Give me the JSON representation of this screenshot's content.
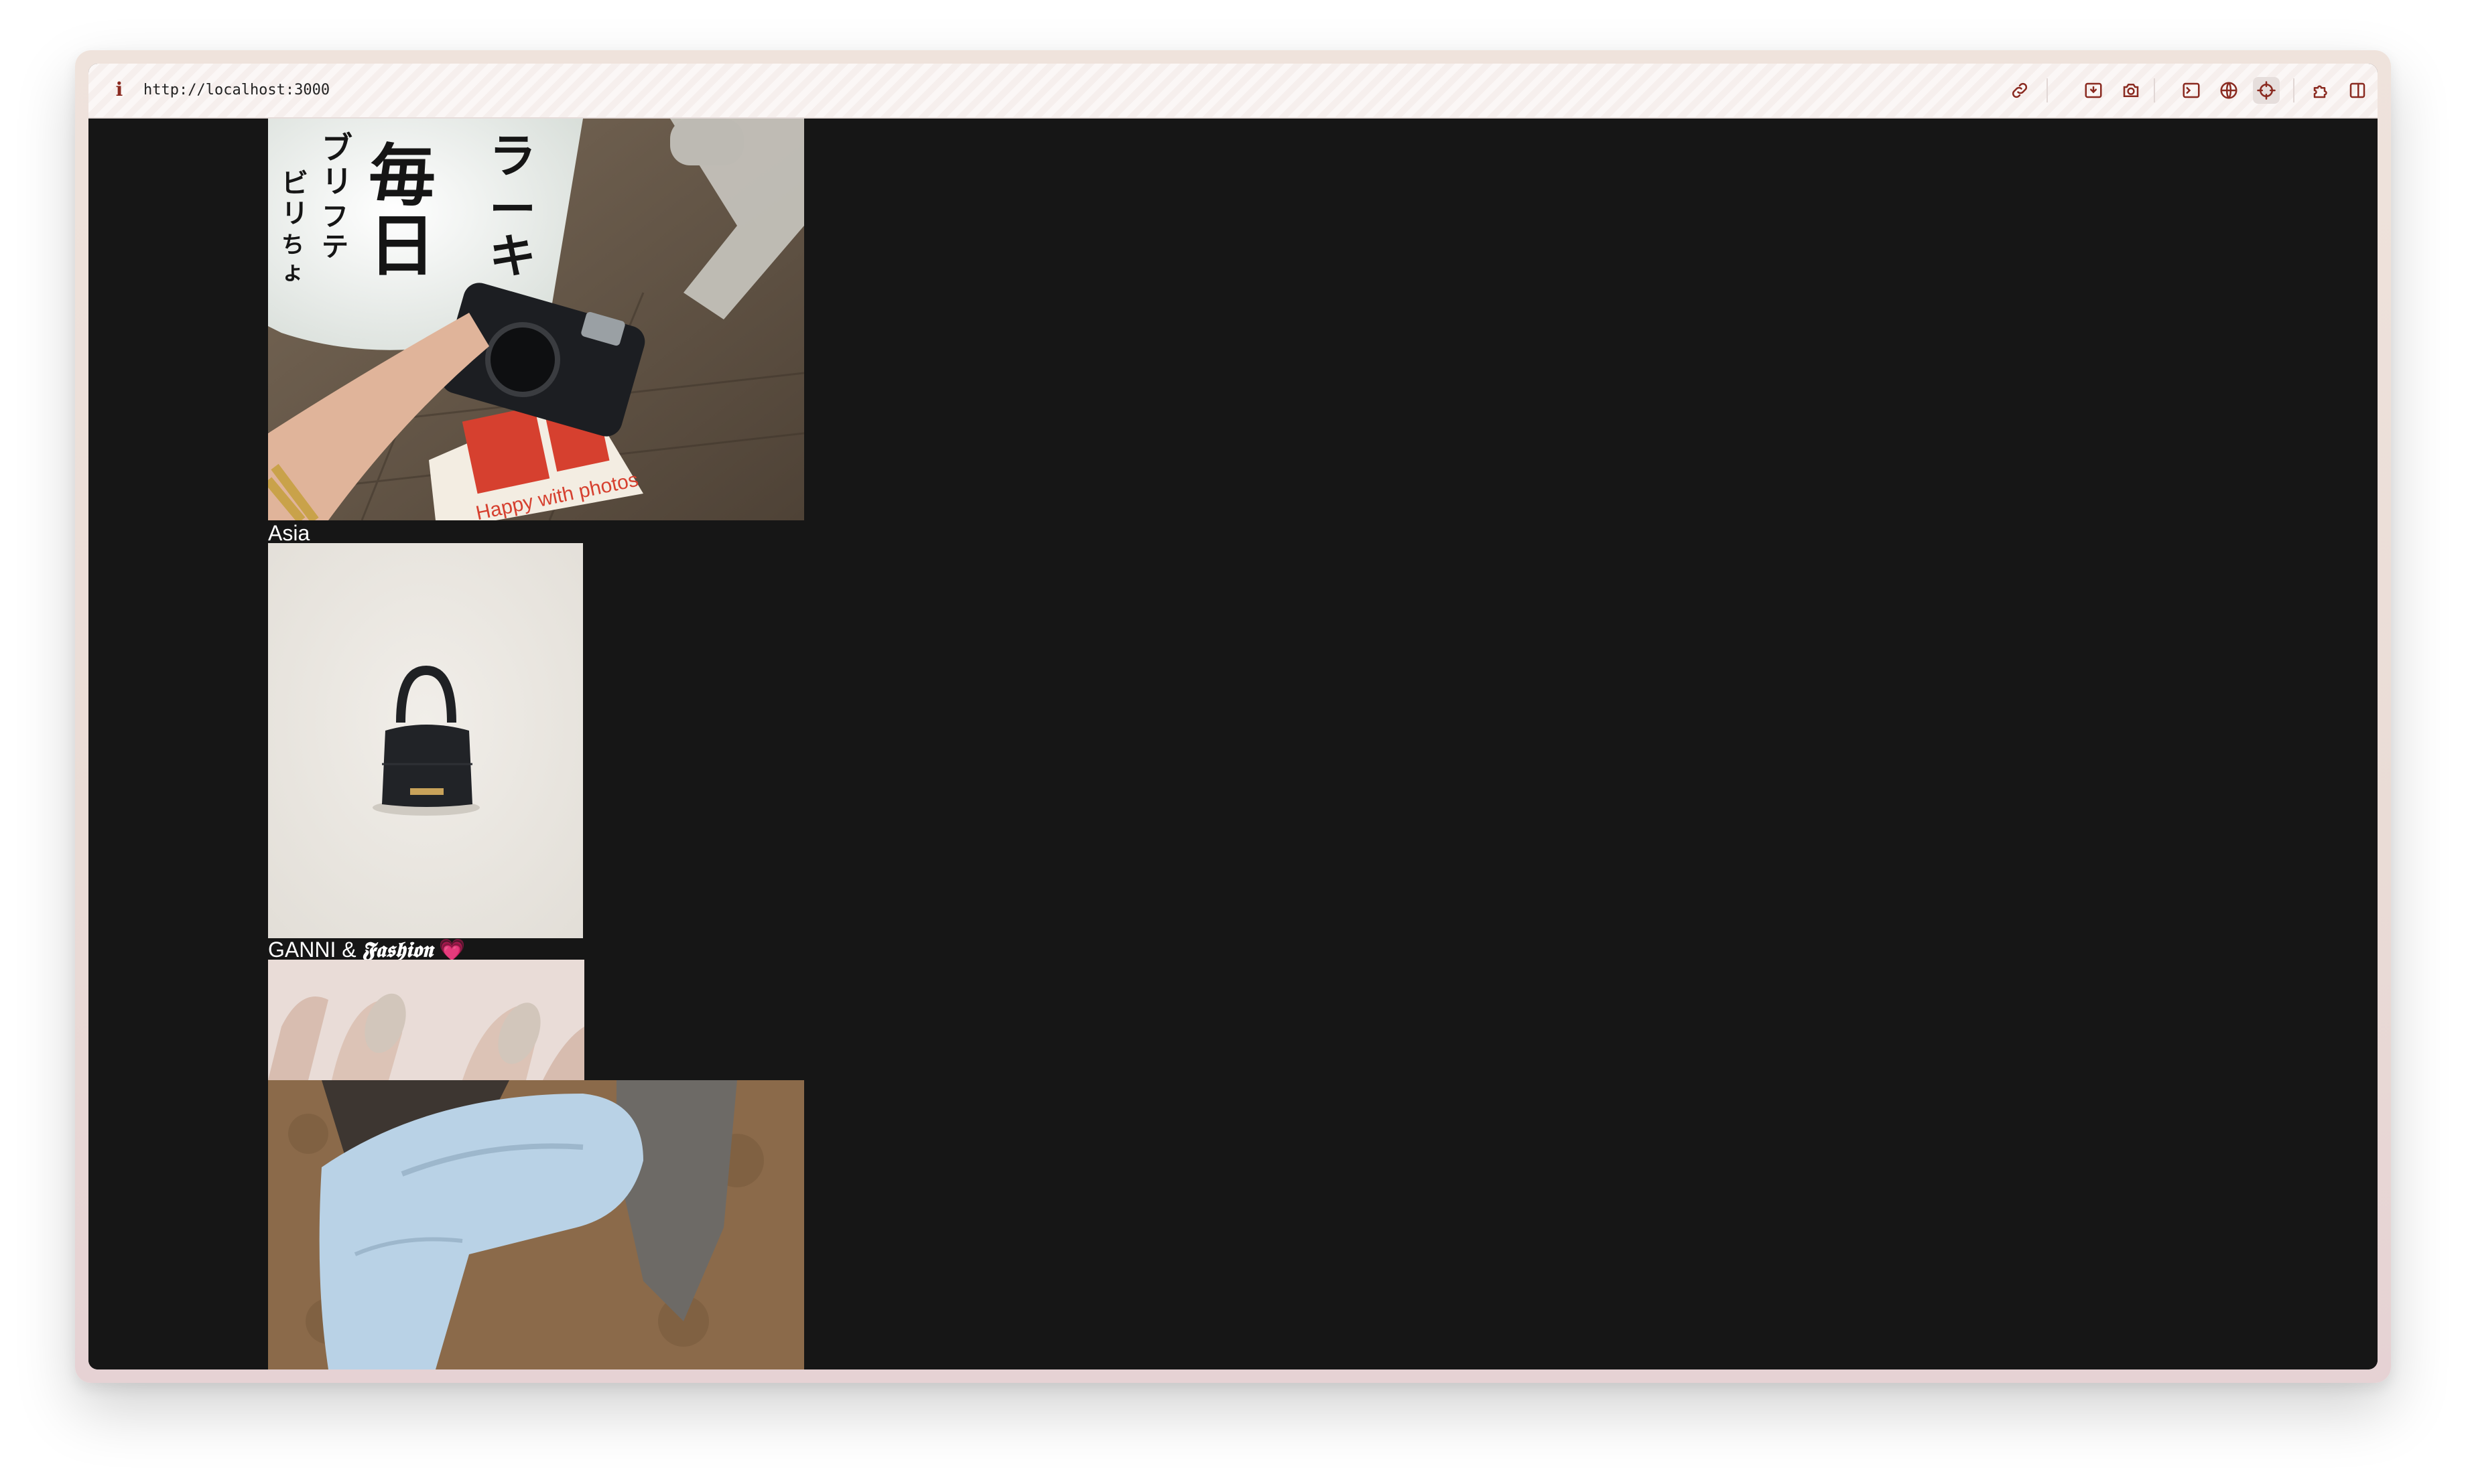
{
  "browser": {
    "url": "http://localhost:3000",
    "info_icon": "info-icon",
    "toolbar_icons": [
      "link-icon",
      "download-icon",
      "camera-icon",
      "terminal-icon",
      "globe-icon",
      "crosshair-icon",
      "puzzle-icon",
      "sidebar-icon"
    ]
  },
  "feed": {
    "posts": [
      {
        "caption": "Asia",
        "image": "camera-photo-japanese-sign"
      },
      {
        "caption_prefix": "GANNI & ",
        "caption_fancy": "𝕱𝖆𝖘𝖍𝖎𝖔𝖓",
        "caption_suffix": " 💗",
        "image": "black-mini-handbag"
      },
      {
        "caption": "",
        "image": "manicured-nails"
      },
      {
        "caption": "",
        "image": "jeans-and-tweed-blazer"
      }
    ]
  },
  "colors": {
    "page_background": "#161616",
    "caption_text": "#ffffff",
    "toolbar_icon": "#8a2a20"
  }
}
